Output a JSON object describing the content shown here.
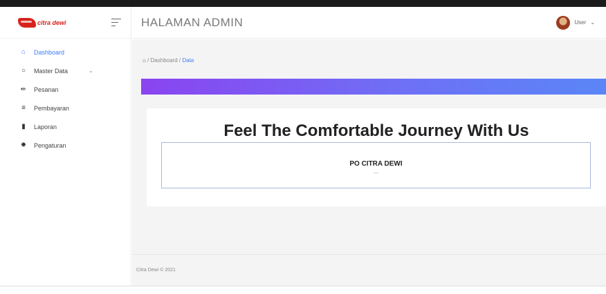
{
  "brand": {
    "logo_text": "citra dewi"
  },
  "header": {
    "title": "HALAMAN ADMIN",
    "user_label": "User",
    "user_chevron": "⌄"
  },
  "sidebar": {
    "items": [
      {
        "label": "Dashboard",
        "icon": "home-icon",
        "glyph": "⌂",
        "active": true
      },
      {
        "label": "Master Data",
        "icon": "circle-icon",
        "glyph": "○",
        "chevron": "⌄"
      },
      {
        "label": "Pesanan",
        "icon": "list-icon",
        "glyph": "⇷"
      },
      {
        "label": "Pembayaran",
        "icon": "menu-icon",
        "glyph": "≡"
      },
      {
        "label": "Laporan",
        "icon": "file-icon",
        "glyph": "▮"
      },
      {
        "label": "Pengaturan",
        "icon": "gear-icon",
        "glyph": "✸"
      }
    ]
  },
  "breadcrumb": {
    "home_glyph": "⌂",
    "sep1": " / ",
    "item1": "Dashboard",
    "sep2": " / ",
    "current": "Data"
  },
  "card": {
    "title": "Feel The Comfortable Journey With Us",
    "company": "PO CITRA DEWI",
    "subtitle": "—"
  },
  "footer": {
    "text": "Citra Dewi © 2021"
  },
  "colors": {
    "accent": "#3d7bfa",
    "banner_start": "#8a44f0",
    "banner_end": "#5a86f7",
    "logo": "#d8231c"
  }
}
